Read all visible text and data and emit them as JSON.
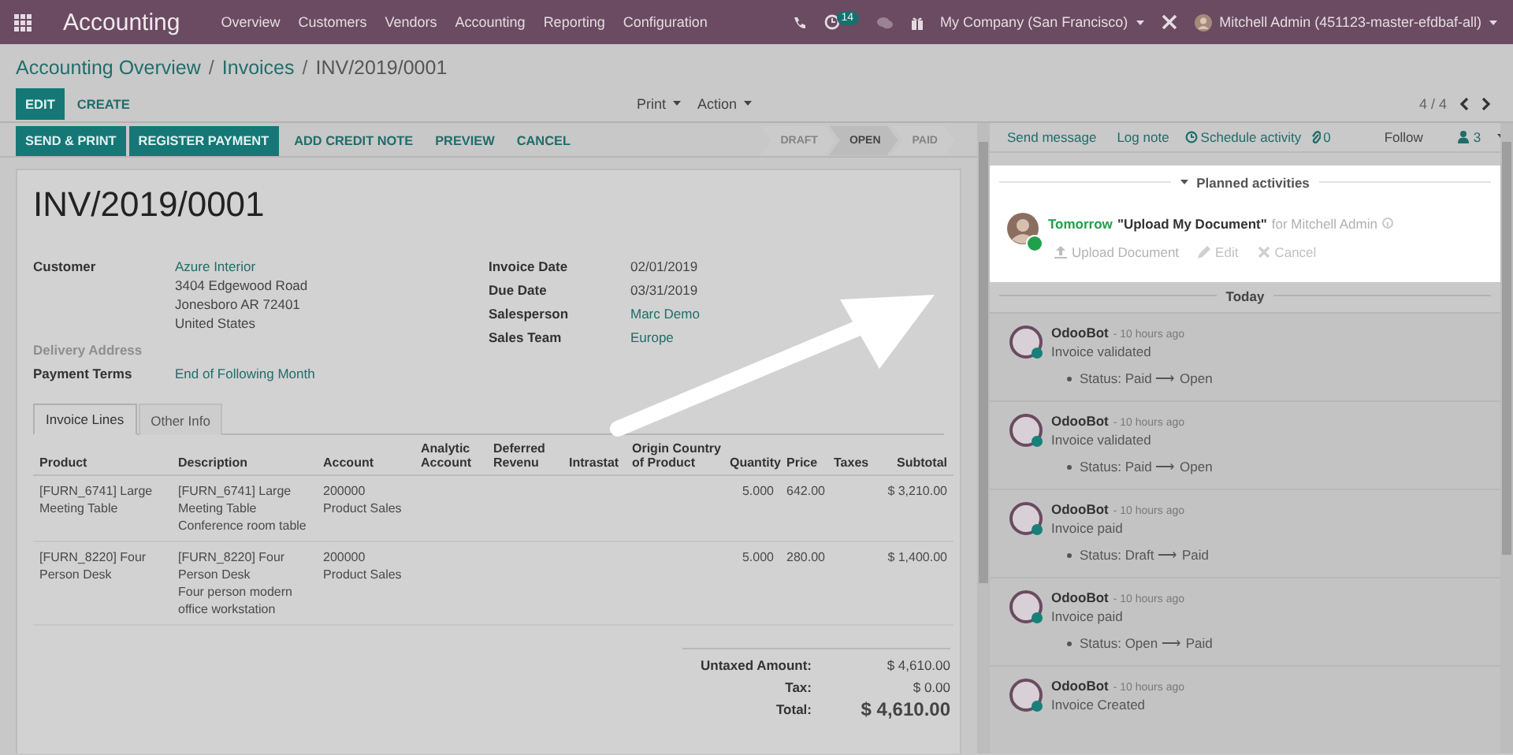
{
  "navbar": {
    "app": "Accounting",
    "menu": [
      "Overview",
      "Customers",
      "Vendors",
      "Accounting",
      "Reporting",
      "Configuration"
    ],
    "activity_count": "14",
    "company": "My Company (San Francisco)",
    "user": "Mitchell Admin (451123-master-efdbaf-all)"
  },
  "breadcrumbs": [
    {
      "label": "Accounting Overview",
      "kind": "link"
    },
    {
      "label": "/",
      "kind": "separator"
    },
    {
      "label": "Invoices",
      "kind": "link"
    },
    {
      "label": "/",
      "kind": "separator"
    },
    {
      "label": "INV/2019/0001",
      "kind": "current"
    }
  ],
  "control_buttons": [
    {
      "label": "EDIT",
      "kind": "primary"
    },
    {
      "label": "CREATE",
      "kind": "secondary"
    }
  ],
  "dropdowns": [
    "Print",
    "Action"
  ],
  "pager": "4 / 4",
  "header_buttons": [
    {
      "label": "SEND & PRINT",
      "kind": "primary"
    },
    {
      "label": "REGISTER PAYMENT",
      "kind": "primary"
    },
    {
      "label": "ADD CREDIT NOTE",
      "kind": "secondary"
    },
    {
      "label": "PREVIEW",
      "kind": "secondary"
    },
    {
      "label": "CANCEL",
      "kind": "secondary"
    }
  ],
  "status_steps": [
    {
      "label": "DRAFT",
      "selected": false
    },
    {
      "label": "OPEN",
      "selected": true
    },
    {
      "label": "PAID",
      "selected": false
    }
  ],
  "invoice": {
    "number": "INV/2019/0001",
    "left_fields": [
      {
        "label": "Customer",
        "kind": "link",
        "value": "Azure Interior",
        "address": [
          "3404 Edgewood Road",
          "Jonesboro AR 72401",
          "United States"
        ]
      },
      {
        "label": "Delivery Address",
        "kind": "empty"
      },
      {
        "label": "Payment Terms",
        "kind": "link",
        "value": "End of Following Month"
      }
    ],
    "right_fields": [
      {
        "label": "Invoice Date",
        "kind": "plain",
        "value": "02/01/2019"
      },
      {
        "label": "Due Date",
        "kind": "plain",
        "value": "03/31/2019"
      },
      {
        "label": "Salesperson",
        "kind": "link",
        "value": "Marc Demo"
      },
      {
        "label": "Sales Team",
        "kind": "link",
        "value": "Europe"
      }
    ],
    "tabs": [
      {
        "label": "Invoice Lines",
        "selected": true
      },
      {
        "label": "Other Info",
        "selected": false
      }
    ],
    "columns": [
      "Product",
      "Description",
      "Account",
      "Analytic\nAccount",
      "Deferred\nRevenu",
      "Intrastat",
      "Origin Country\nof Product",
      "Quantity",
      "Price",
      "Taxes",
      "Subtotal"
    ],
    "rows": [
      [
        "[FURN_6741] Large Meeting Table",
        "[FURN_6741] Large Meeting Table\nConference room table",
        "200000\nProduct Sales",
        "",
        "",
        "",
        "",
        "5.000",
        "642.00",
        "",
        "$ 3,210.00"
      ],
      [
        "[FURN_8220] Four Person Desk",
        "[FURN_8220] Four Person Desk\nFour person modern office workstation",
        "200000\nProduct Sales",
        "",
        "",
        "",
        "",
        "5.000",
        "280.00",
        "",
        "$ 1,400.00"
      ]
    ],
    "totals": [
      {
        "label": "Untaxed Amount:",
        "value": "$ 4,610.00",
        "kind": "line"
      },
      {
        "label": "Tax:",
        "value": "$ 0.00",
        "kind": "line"
      },
      {
        "label": "Total:",
        "value": "$ 4,610.00",
        "kind": "grand"
      }
    ]
  },
  "chatter": {
    "actions": [
      "Send message",
      "Log note",
      "Schedule activity"
    ],
    "attachments": "0",
    "follow": "Follow",
    "followers": "3",
    "planned_title": "Planned activities",
    "activity": {
      "when": "Tomorrow",
      "summary": "\"Upload My Document\"",
      "assignee": "for Mitchell Admin",
      "actions": [
        "Upload Document",
        "Edit",
        "Cancel"
      ]
    },
    "separator": "Today",
    "messages": [
      {
        "author": "OdooBot",
        "time": "- 10 hours ago",
        "body": "Invoice validated",
        "tracking": "Status: Paid ⟶ Open"
      },
      {
        "author": "OdooBot",
        "time": "- 10 hours ago",
        "body": "Invoice validated",
        "tracking": "Status: Paid ⟶ Open"
      },
      {
        "author": "OdooBot",
        "time": "- 10 hours ago",
        "body": "Invoice paid",
        "tracking": "Status: Draft ⟶ Paid"
      },
      {
        "author": "OdooBot",
        "time": "- 10 hours ago",
        "body": "Invoice paid",
        "tracking": "Status: Open ⟶ Paid"
      },
      {
        "author": "OdooBot",
        "time": "- 10 hours ago",
        "body": "Invoice Created"
      }
    ]
  }
}
